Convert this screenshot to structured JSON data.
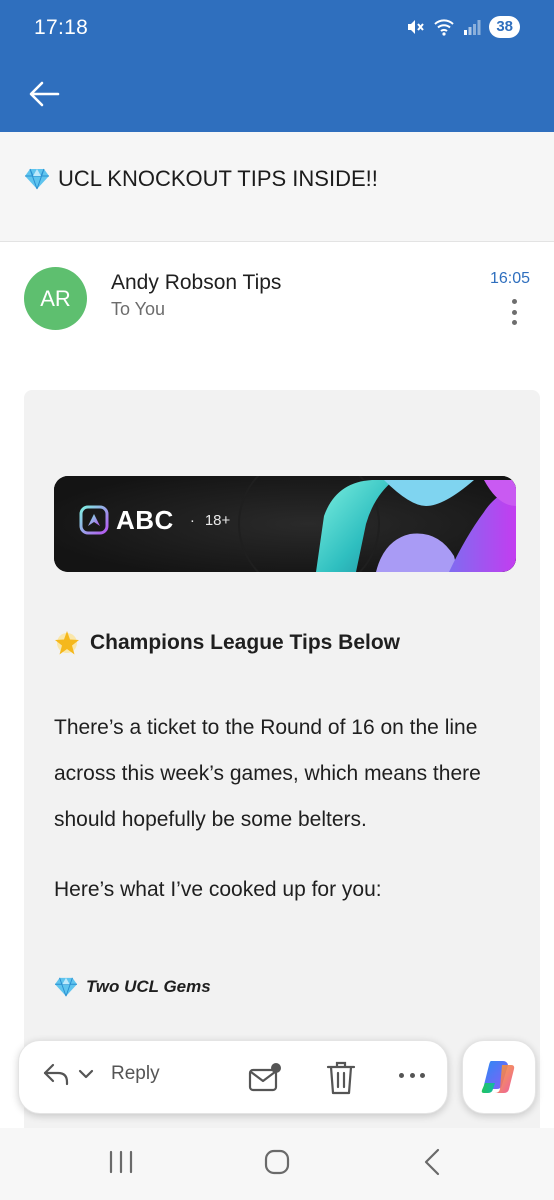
{
  "status_bar": {
    "time": "17:18",
    "battery": "38",
    "icons": [
      "mute-icon",
      "wifi-icon",
      "signal-icon"
    ]
  },
  "app_bar": {
    "back_icon": "arrow-left-icon"
  },
  "email": {
    "subject": "UCL KNOCKOUT TIPS INSIDE!!",
    "subject_icon": "gem-icon",
    "sender_initials": "AR",
    "sender_name": "Andy Robson Tips",
    "recipient": "To You",
    "time": "16:05",
    "avatar_color": "#5ebf6f"
  },
  "body": {
    "banner": {
      "brand": "ABC",
      "separator": "·",
      "age": "18+"
    },
    "section_title": "Champions League Tips Below",
    "section_icon": "star-icon",
    "paragraph_1": "There’s a ticket to the Round of 16 on the line across this week’s games, which means there should hopefully be some belters.",
    "paragraph_2": "Here’s what I’ve cooked up for you:",
    "gems_title": "Two UCL Gems",
    "gems_icon": "gem-icon"
  },
  "action_bar": {
    "reply_label": "Reply",
    "icons": [
      "reply-icon",
      "chevron-down-icon",
      "mark-unread-icon",
      "trash-icon",
      "more-horizontal-icon",
      "copilot-icon"
    ]
  },
  "nav_bar": {
    "icons": [
      "recent-apps-icon",
      "home-icon",
      "back-icon"
    ]
  },
  "colors": {
    "brand_blue": "#2f6fbe",
    "body_background": "#f2f2f2"
  }
}
